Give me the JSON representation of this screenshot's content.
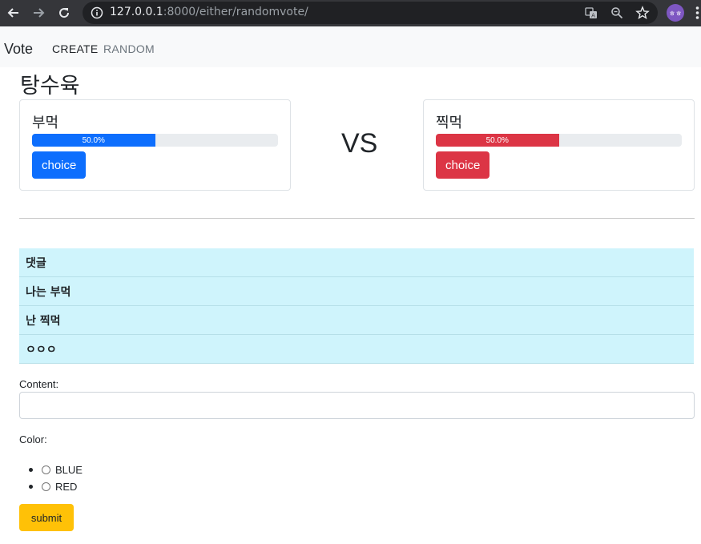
{
  "browser": {
    "url_host": "127.0.0.1",
    "url_rest": ":8000/either/randomvote/",
    "avatar_text": "ㅎㅎ",
    "icons": [
      "back-arrow-icon",
      "forward-arrow-icon",
      "reload-icon",
      "info-icon",
      "translate-icon",
      "zoom-icon",
      "star-icon",
      "kebab-menu-icon"
    ]
  },
  "navbar": {
    "brand": "Vote",
    "links": [
      {
        "label": "CREATE",
        "active": true
      },
      {
        "label": "RANDOM",
        "active": false
      }
    ]
  },
  "vote": {
    "title": "탕수육",
    "vs_label": "VS",
    "left": {
      "name": "부먹",
      "percent": 50.0,
      "percent_label": "50.0%",
      "button_label": "choice",
      "color": "#0d6efd"
    },
    "right": {
      "name": "찍먹",
      "percent": 50.0,
      "percent_label": "50.0%",
      "button_label": "choice",
      "color": "#dc3545"
    }
  },
  "comments": {
    "header": "댓글",
    "items": [
      "나는 부먹",
      "난 찍먹",
      "ㅇㅇㅇ"
    ]
  },
  "form": {
    "content_label": "Content:",
    "content_value": "",
    "color_label": "Color:",
    "color_options": [
      "BLUE",
      "RED"
    ],
    "submit_label": "submit"
  },
  "colors": {
    "comment_bg": "#cff4fc",
    "submit_bg": "#ffc107"
  }
}
